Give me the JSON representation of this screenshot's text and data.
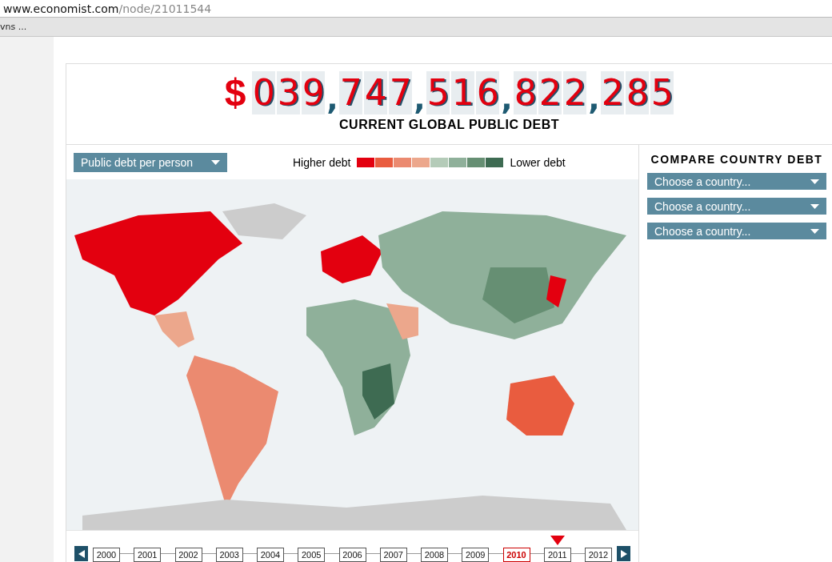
{
  "browser": {
    "address_host": "www.economist.com",
    "address_path": "/node/21011544",
    "bookmark": "vns ..."
  },
  "counter": {
    "currency": "$",
    "groups": [
      "039",
      "747",
      "516",
      "822",
      "285"
    ],
    "separator": ",",
    "caption": "CURRENT GLOBAL PUBLIC DEBT"
  },
  "measure_dropdown": {
    "value": "Public debt per person"
  },
  "legend": {
    "high_label": "Higher debt",
    "low_label": "Lower debt",
    "swatches": [
      {
        "color": "#e3000f"
      },
      {
        "color": "#e95c3f"
      },
      {
        "color": "#eb8a70"
      },
      {
        "color": "#eca78c"
      },
      {
        "color": "#b4cbb8"
      },
      {
        "color": "#8fb09a"
      },
      {
        "color": "#668f73"
      },
      {
        "color": "#3e6b52"
      }
    ]
  },
  "timeline": {
    "years": [
      {
        "label": "2000",
        "selected": false,
        "marked": false
      },
      {
        "label": "2001",
        "selected": false,
        "marked": false
      },
      {
        "label": "2002",
        "selected": false,
        "marked": false
      },
      {
        "label": "2003",
        "selected": false,
        "marked": false
      },
      {
        "label": "2004",
        "selected": false,
        "marked": false
      },
      {
        "label": "2005",
        "selected": false,
        "marked": false
      },
      {
        "label": "2006",
        "selected": false,
        "marked": false
      },
      {
        "label": "2007",
        "selected": false,
        "marked": false
      },
      {
        "label": "2008",
        "selected": false,
        "marked": false
      },
      {
        "label": "2009",
        "selected": false,
        "marked": false
      },
      {
        "label": "2010",
        "selected": true,
        "marked": false
      },
      {
        "label": "2011",
        "selected": false,
        "marked": true
      },
      {
        "label": "2012",
        "selected": false,
        "marked": false
      }
    ]
  },
  "compare": {
    "title": "COMPARE COUNTRY DEBT",
    "dropdowns": [
      {
        "placeholder": "Choose a country..."
      },
      {
        "placeholder": "Choose a country..."
      },
      {
        "placeholder": "Choose a country..."
      }
    ]
  }
}
